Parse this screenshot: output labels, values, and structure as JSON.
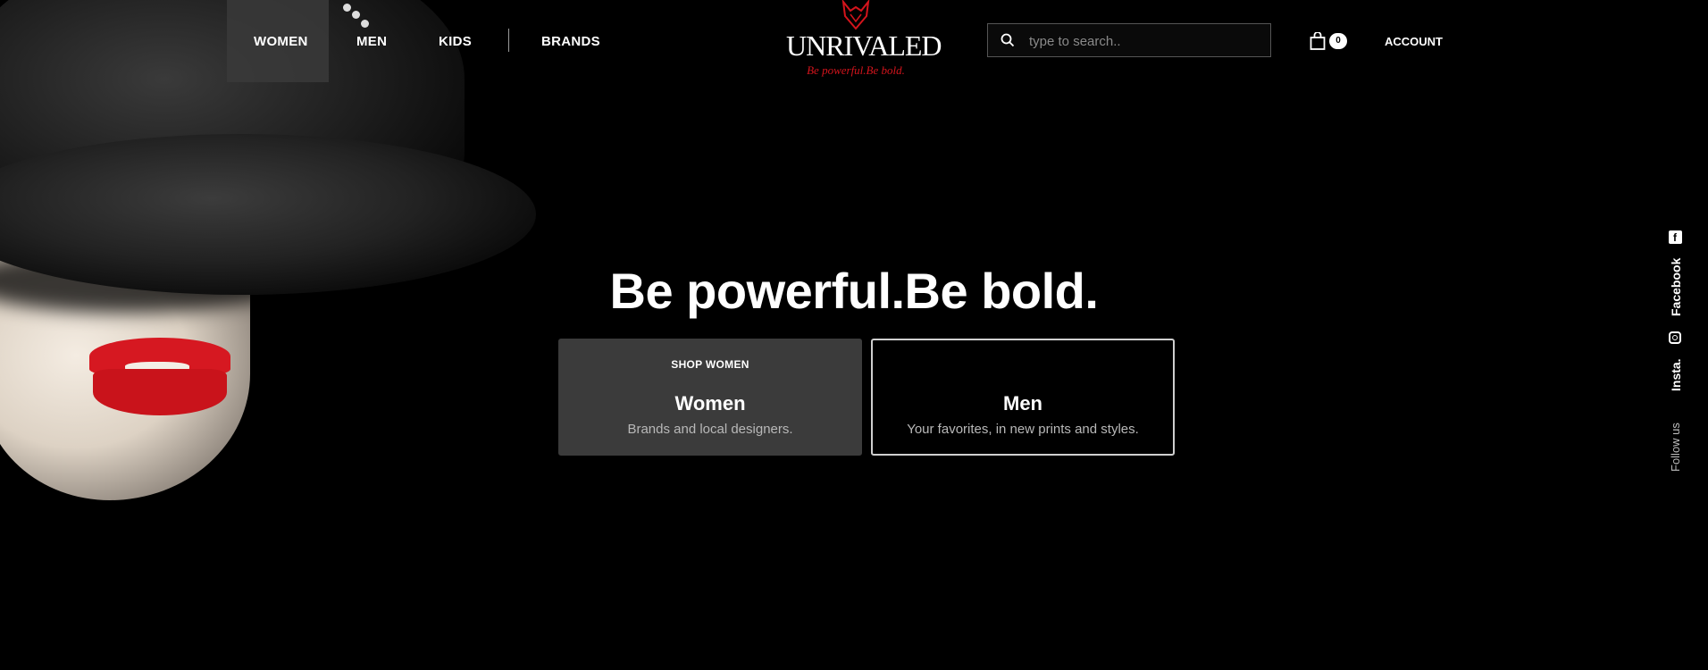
{
  "nav": {
    "items": [
      {
        "label": "WOMEN",
        "active": true
      },
      {
        "label": "MEN",
        "active": false
      },
      {
        "label": "KIDS",
        "active": false
      },
      {
        "label": "BRANDS",
        "active": false
      }
    ]
  },
  "logo": {
    "wordmark": "UNRIVALED",
    "tagline": "Be powerful.Be bold."
  },
  "search": {
    "placeholder": "type to search.."
  },
  "cart": {
    "count": "0"
  },
  "account": {
    "label": "ACCOUNT"
  },
  "hero": {
    "headline": "Be powerful.Be bold.",
    "cards": [
      {
        "eyebrow": "SHOP WOMEN",
        "title": "Women",
        "subtitle": "Brands and local designers."
      },
      {
        "eyebrow": "",
        "title": "Men",
        "subtitle": "Your favorites, in new prints and styles."
      }
    ]
  },
  "social": {
    "follow_label": "Follow us",
    "links": [
      {
        "label": "Facebook",
        "icon": "facebook-icon"
      },
      {
        "label": "Insta.",
        "icon": "instagram-icon"
      }
    ]
  },
  "colors": {
    "background": "#000000",
    "accent_red": "#d4141c",
    "active_nav_bg": "#3a3a3a"
  }
}
